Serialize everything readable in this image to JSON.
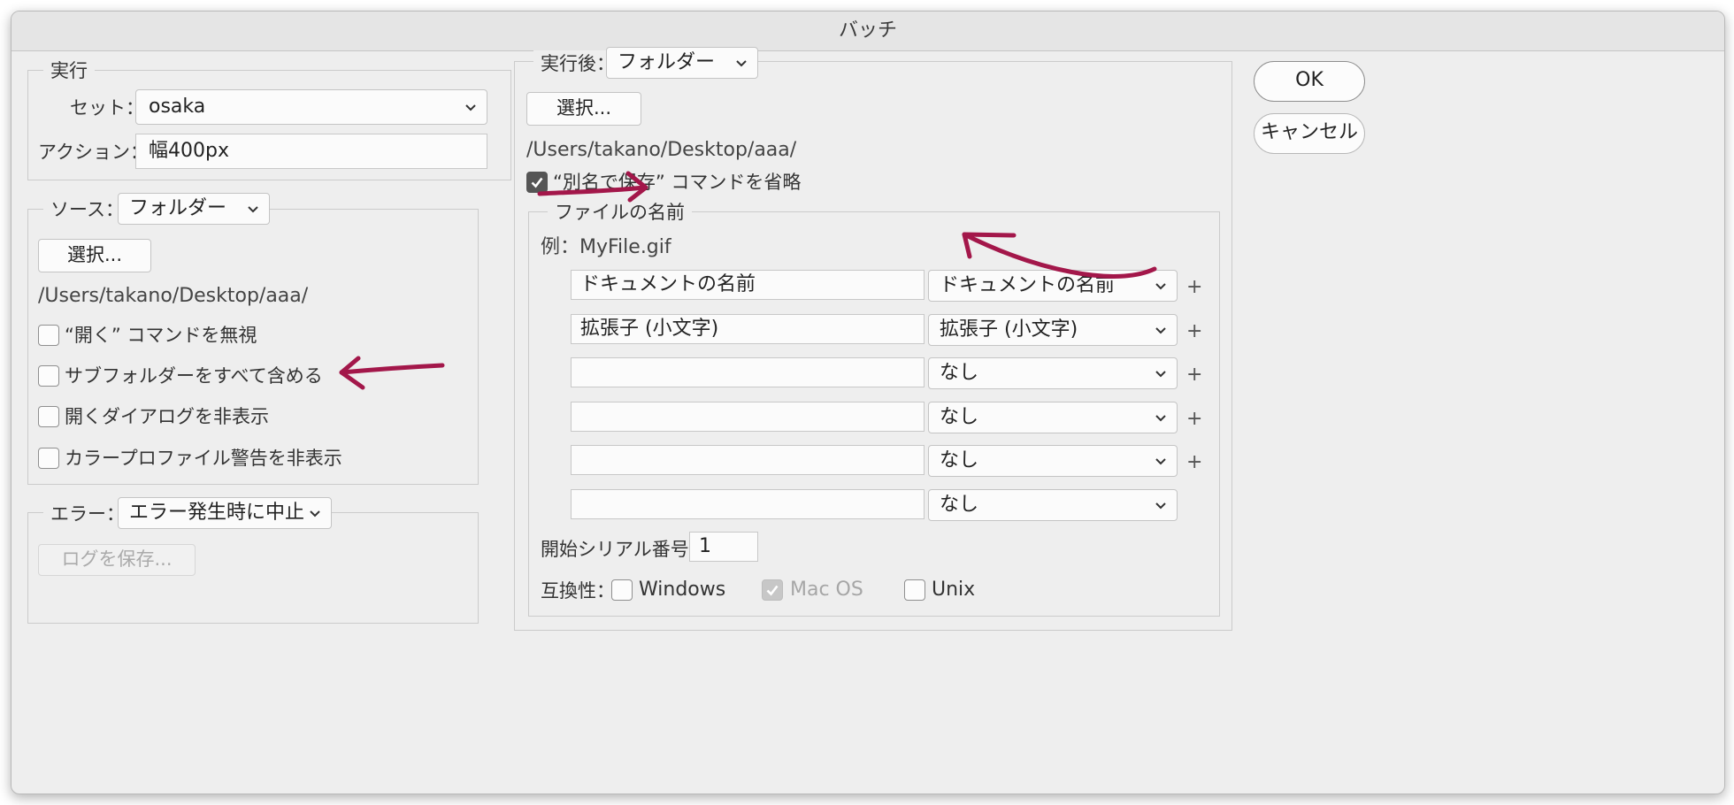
{
  "window": {
    "title": "バッチ"
  },
  "play": {
    "legend": "実行",
    "set_label": "セット：",
    "set_value": "osaka",
    "action_label": "アクション：",
    "action_value": "幅400px"
  },
  "source": {
    "label": "ソース：",
    "value": "フォルダー",
    "choose": "選択...",
    "path": "/Users/takano/Desktop/aaa/",
    "options": [
      {
        "label": "“開く” コマンドを無視",
        "checked": false
      },
      {
        "label": "サブフォルダーをすべて含める",
        "checked": false
      },
      {
        "label": "開くダイアログを非表示",
        "checked": false
      },
      {
        "label": "カラープロファイル警告を非表示",
        "checked": false
      }
    ]
  },
  "errors": {
    "label": "エラー：",
    "value": "エラー発生時に中止",
    "save_log": "ログを保存..."
  },
  "destination": {
    "label": "実行後：",
    "value": "フォルダー",
    "choose": "選択...",
    "path": "/Users/takano/Desktop/aaa/",
    "override_save_as": {
      "label": "“別名で保存” コマンドを省略",
      "checked": true
    },
    "file_naming": {
      "legend": "ファイルの名前",
      "example": "例：MyFile.gif",
      "rows": [
        {
          "text": "ドキュメントの名前",
          "select": "ドキュメントの名前",
          "plus": "+"
        },
        {
          "text": "拡張子 (小文字)",
          "select": "拡張子 (小文字)",
          "plus": "+"
        },
        {
          "text": "",
          "select": "なし",
          "plus": "+"
        },
        {
          "text": "",
          "select": "なし",
          "plus": "+"
        },
        {
          "text": "",
          "select": "なし",
          "plus": "+"
        },
        {
          "text": "",
          "select": "なし",
          "plus": ""
        }
      ],
      "serial_label": "開始シリアル番号：",
      "serial_value": "1",
      "compat_label": "互換性：",
      "compat": [
        {
          "label": "Windows",
          "checked": false,
          "disabled": false
        },
        {
          "label": "Mac OS",
          "checked": true,
          "disabled": true
        },
        {
          "label": "Unix",
          "checked": false,
          "disabled": false
        }
      ]
    }
  },
  "buttons": {
    "ok": "OK",
    "cancel": "キャンセル"
  },
  "annotations": {
    "arrow_color": "#a3174a"
  },
  "icons": {
    "select": "chevron-down-icon",
    "checkbox": "checkmark-icon",
    "arrow": "curved-arrow"
  }
}
